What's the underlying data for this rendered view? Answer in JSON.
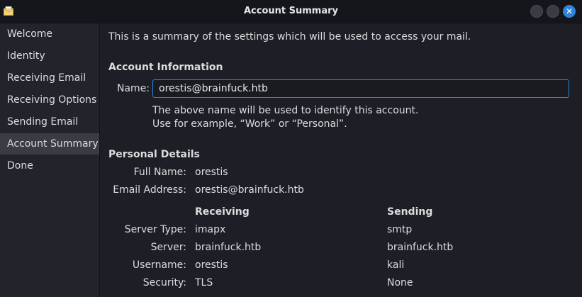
{
  "window": {
    "title": "Account Summary"
  },
  "sidebar": {
    "items": [
      {
        "label": "Welcome"
      },
      {
        "label": "Identity"
      },
      {
        "label": "Receiving Email"
      },
      {
        "label": "Receiving Options"
      },
      {
        "label": "Sending Email"
      },
      {
        "label": "Account Summary",
        "active": true
      },
      {
        "label": "Done"
      }
    ]
  },
  "main": {
    "intro": "This is a summary of the settings which will be used to access your mail.",
    "account_info": {
      "heading": "Account Information",
      "name_label": "Name:",
      "name_value": "orestis@brainfuck.htb",
      "hint1": "The above name will be used to identify this account.",
      "hint2": "Use for example, “Work” or “Personal”."
    },
    "personal": {
      "heading": "Personal Details",
      "full_name_label": "Full Name:",
      "full_name": "orestis",
      "email_label": "Email Address:",
      "email": "orestis@brainfuck.htb"
    },
    "servers": {
      "receiving_heading": "Receiving",
      "sending_heading": "Sending",
      "rows": [
        {
          "label": "Server Type:",
          "receiving": "imapx",
          "sending": "smtp"
        },
        {
          "label": "Server:",
          "receiving": "brainfuck.htb",
          "sending": "brainfuck.htb"
        },
        {
          "label": "Username:",
          "receiving": "orestis",
          "sending": "kali"
        },
        {
          "label": "Security:",
          "receiving": "TLS",
          "sending": "None"
        }
      ]
    }
  }
}
